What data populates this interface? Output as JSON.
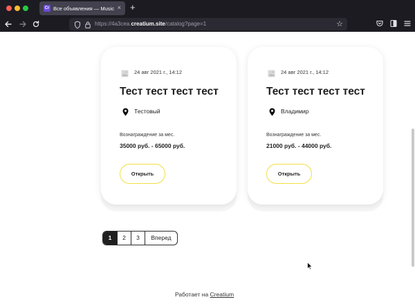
{
  "browser": {
    "tab_title": "Все объявления — Musically",
    "favicon_text": "Cr",
    "tab_close": "×",
    "new_tab": "+",
    "url_prefix": "https://4a3cea.",
    "url_domain": "creatium.site",
    "url_path": "/catalog?page=1",
    "icons": {
      "back": "back-arrow-icon",
      "forward": "forward-arrow-icon",
      "reload": "reload-icon",
      "shield": "shield-icon",
      "lock": "lock-icon",
      "bookmark": "star-icon",
      "pocket": "pocket-icon",
      "extensions": "extension-icon",
      "menu": "hamburger-menu-icon"
    }
  },
  "cards": [
    {
      "date": "24 авг 2021 г., 14:12",
      "title": "Тест тест тест тест",
      "city": "Тестовый",
      "reward_label": "Вознаграждение за мес.",
      "salary": "35000 руб. - 65000 руб.",
      "button": "Открыть"
    },
    {
      "date": "24 авг 2021 г., 14:12",
      "title": "Тест тест тест тест",
      "city": "Владимир",
      "reward_label": "Вознаграждение за мес.",
      "salary": "21000 руб. - 44000 руб.",
      "button": "Открыть"
    }
  ],
  "pagination": {
    "pages": [
      "1",
      "2",
      "3"
    ],
    "active": "1",
    "next": "Вперед"
  },
  "footer": {
    "prefix": "Работает на",
    "link": "Creatium"
  },
  "colors": {
    "accent_border": "#f3de43",
    "chrome_bg": "#1c1b22"
  }
}
